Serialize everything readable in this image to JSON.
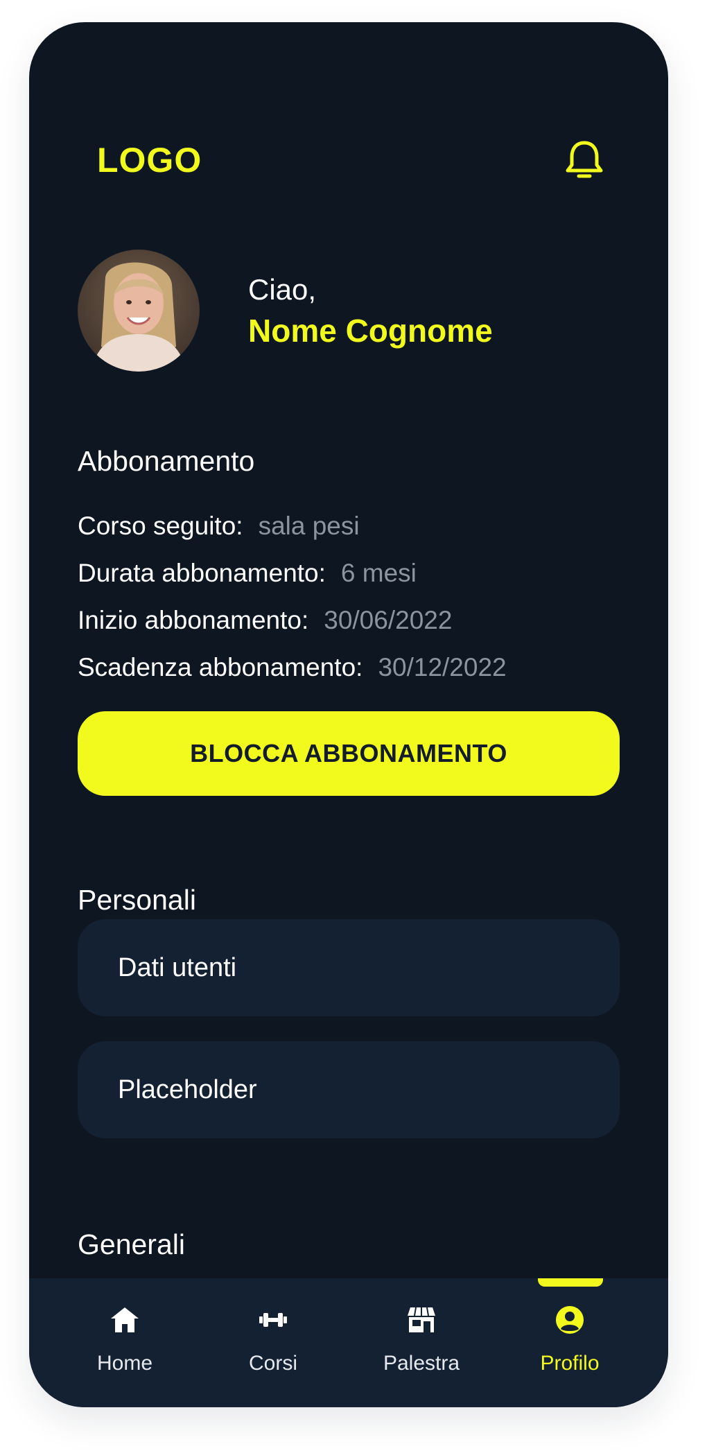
{
  "header": {
    "logo_text": "LOGO",
    "notification_icon": "bell-icon"
  },
  "profile": {
    "greeting": "Ciao,",
    "name": "Nome Cognome"
  },
  "subscription": {
    "title": "Abbonamento",
    "rows": [
      {
        "label": "Corso seguito:",
        "value": "sala pesi"
      },
      {
        "label": "Durata abbonamento:",
        "value": "6 mesi"
      },
      {
        "label": "Inizio abbonamento:",
        "value": "30/06/2022"
      },
      {
        "label": "Scadenza abbonamento:",
        "value": "30/12/2022"
      }
    ],
    "block_button": "BLOCCA ABBONAMENTO"
  },
  "personal": {
    "title": "Personali",
    "items": [
      {
        "label": "Dati utenti"
      },
      {
        "label": "Placeholder"
      }
    ]
  },
  "general": {
    "title": "Generali"
  },
  "tabbar": {
    "tabs": [
      {
        "label": "Home",
        "icon": "home-icon"
      },
      {
        "label": "Corsi",
        "icon": "dumbbell-icon"
      },
      {
        "label": "Palestra",
        "icon": "store-icon"
      },
      {
        "label": "Profilo",
        "icon": "user-circle-icon",
        "active": true
      }
    ]
  },
  "colors": {
    "background": "#0e1621",
    "card": "#142133",
    "accent": "#f2f91c",
    "muted_text": "#8c94a0"
  }
}
